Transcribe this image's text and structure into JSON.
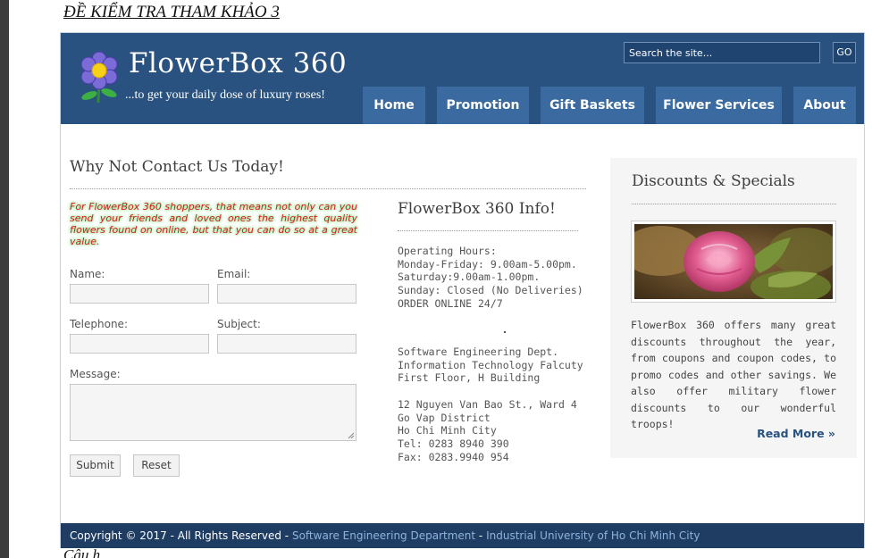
{
  "document": {
    "heading": "ĐỀ KIỂM TRA THAM KHẢO 3",
    "caption": "Câu h"
  },
  "header": {
    "site_title": "FlowerBox 360",
    "tagline": "...to get your daily dose of luxury roses!",
    "search_placeholder": "Search the site...",
    "search_button": "GO",
    "nav": [
      "Home",
      "Promotion",
      "Gift Baskets",
      "Flower Services",
      "About"
    ]
  },
  "contact": {
    "title": "Why Not Contact Us Today!",
    "promo": "For FlowerBox 360 shoppers, that means not only can you send your friends and loved ones the highest quality flowers found on online, but that you can do so at a great value.",
    "labels": {
      "name": "Name:",
      "email": "Email:",
      "telephone": "Telephone:",
      "subject": "Subject:",
      "message": "Message:"
    },
    "submit": "Submit",
    "reset": "Reset"
  },
  "info": {
    "title": "FlowerBox 360 Info!",
    "hours": [
      "Operating Hours:",
      "Monday-Friday: 9.00am-5.00pm.",
      "Saturday:9.00am-1.00pm.",
      "Sunday: Closed (No Deliveries)",
      "ORDER ONLINE 24/7"
    ],
    "dept": [
      "Software Engineering Dept.",
      "Information Technology Falcuty",
      "First Floor, H Building"
    ],
    "address": [
      "12 Nguyen Van Bao St., Ward 4",
      "Go Vap District",
      "Ho Chi Minh City",
      "Tel: 0283 8940 390",
      "Fax: 0283.9940 954"
    ]
  },
  "sidebar": {
    "title": "Discounts & Specials",
    "text": "FlowerBox 360 offers many great discounts throughout the year, from coupons and coupon codes, to promo codes and other savings. We also offer military flower discounts to our wonderful troops!",
    "read_more": "Read More »"
  },
  "footer": {
    "copyright": "Copyright © 2017 - All Rights Reserved",
    "separator": " - ",
    "link1": "Software Engineering Department",
    "link2": "Industrial University of Ho Chi Minh City"
  },
  "colors": {
    "header_bg": "#2a5280",
    "nav_bg": "#3a6a9f",
    "footer_bg": "#1f3d63",
    "promo_text": "#d71c1c",
    "link": "#2a5280"
  },
  "icons": [
    "flower-logo-icon"
  ]
}
